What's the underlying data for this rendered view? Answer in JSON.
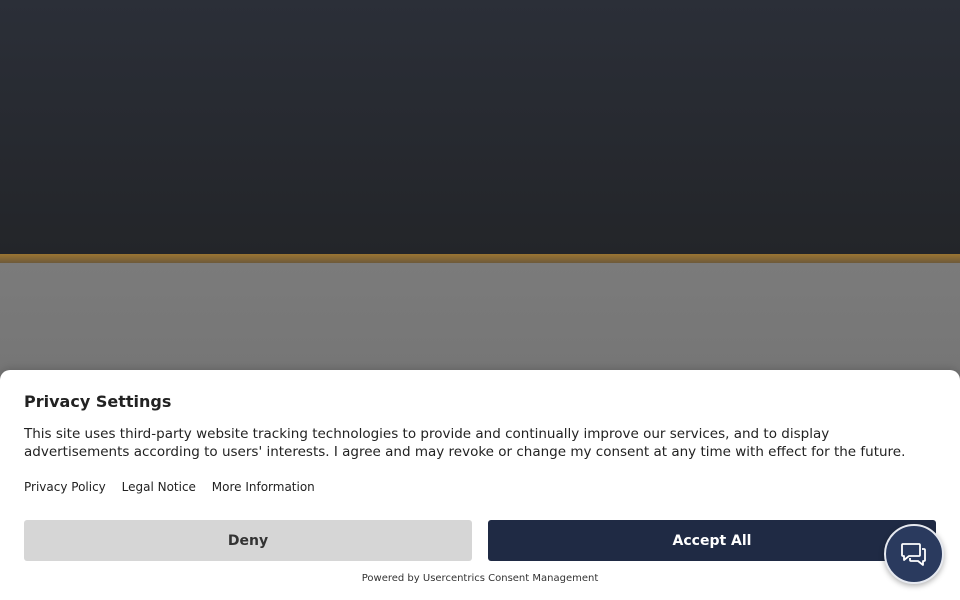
{
  "consent": {
    "title": "Privacy Settings",
    "text": "This site uses third-party website tracking technologies to provide and continually improve our services, and to display advertisements according to users' interests. I agree and may revoke or change my consent at any time with effect for the future.",
    "links": {
      "privacy_policy": "Privacy Policy",
      "legal_notice": "Legal Notice",
      "more_information": "More Information"
    },
    "deny_label": "Deny",
    "accept_label": "Accept All",
    "powered_by": "Powered by Usercentrics Consent Management"
  },
  "chat": {
    "icon": "chat-bubbles-icon"
  },
  "colors": {
    "accent_bar": "#9a7432",
    "accept_button": "#1f2a44",
    "deny_button": "#d6d6d6",
    "chat_button": "#2a3a5e"
  }
}
